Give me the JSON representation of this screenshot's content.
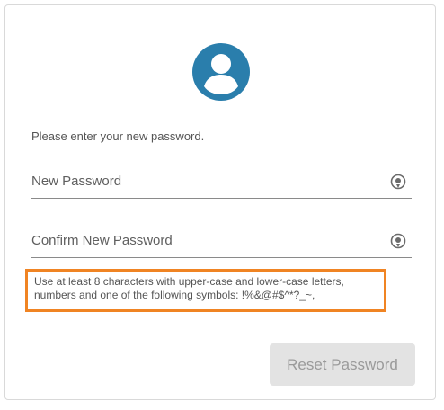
{
  "form": {
    "avatar_icon": "user-avatar-icon",
    "accent_color": "#2a7eac",
    "prompt": "Please enter your new password.",
    "new_password": {
      "placeholder": "New Password",
      "value": "",
      "toggle_icon": "show-password-icon"
    },
    "confirm_password": {
      "placeholder": "Confirm New Password",
      "value": "",
      "toggle_icon": "show-password-icon"
    },
    "hint_lines": [
      "Use at least 8 characters with upper-case and lower-case letters,",
      "numbers and one of the following symbols: !%&@#$^*?_~,"
    ],
    "hint_border_color": "#f08423",
    "reset_label": "Reset Password"
  }
}
